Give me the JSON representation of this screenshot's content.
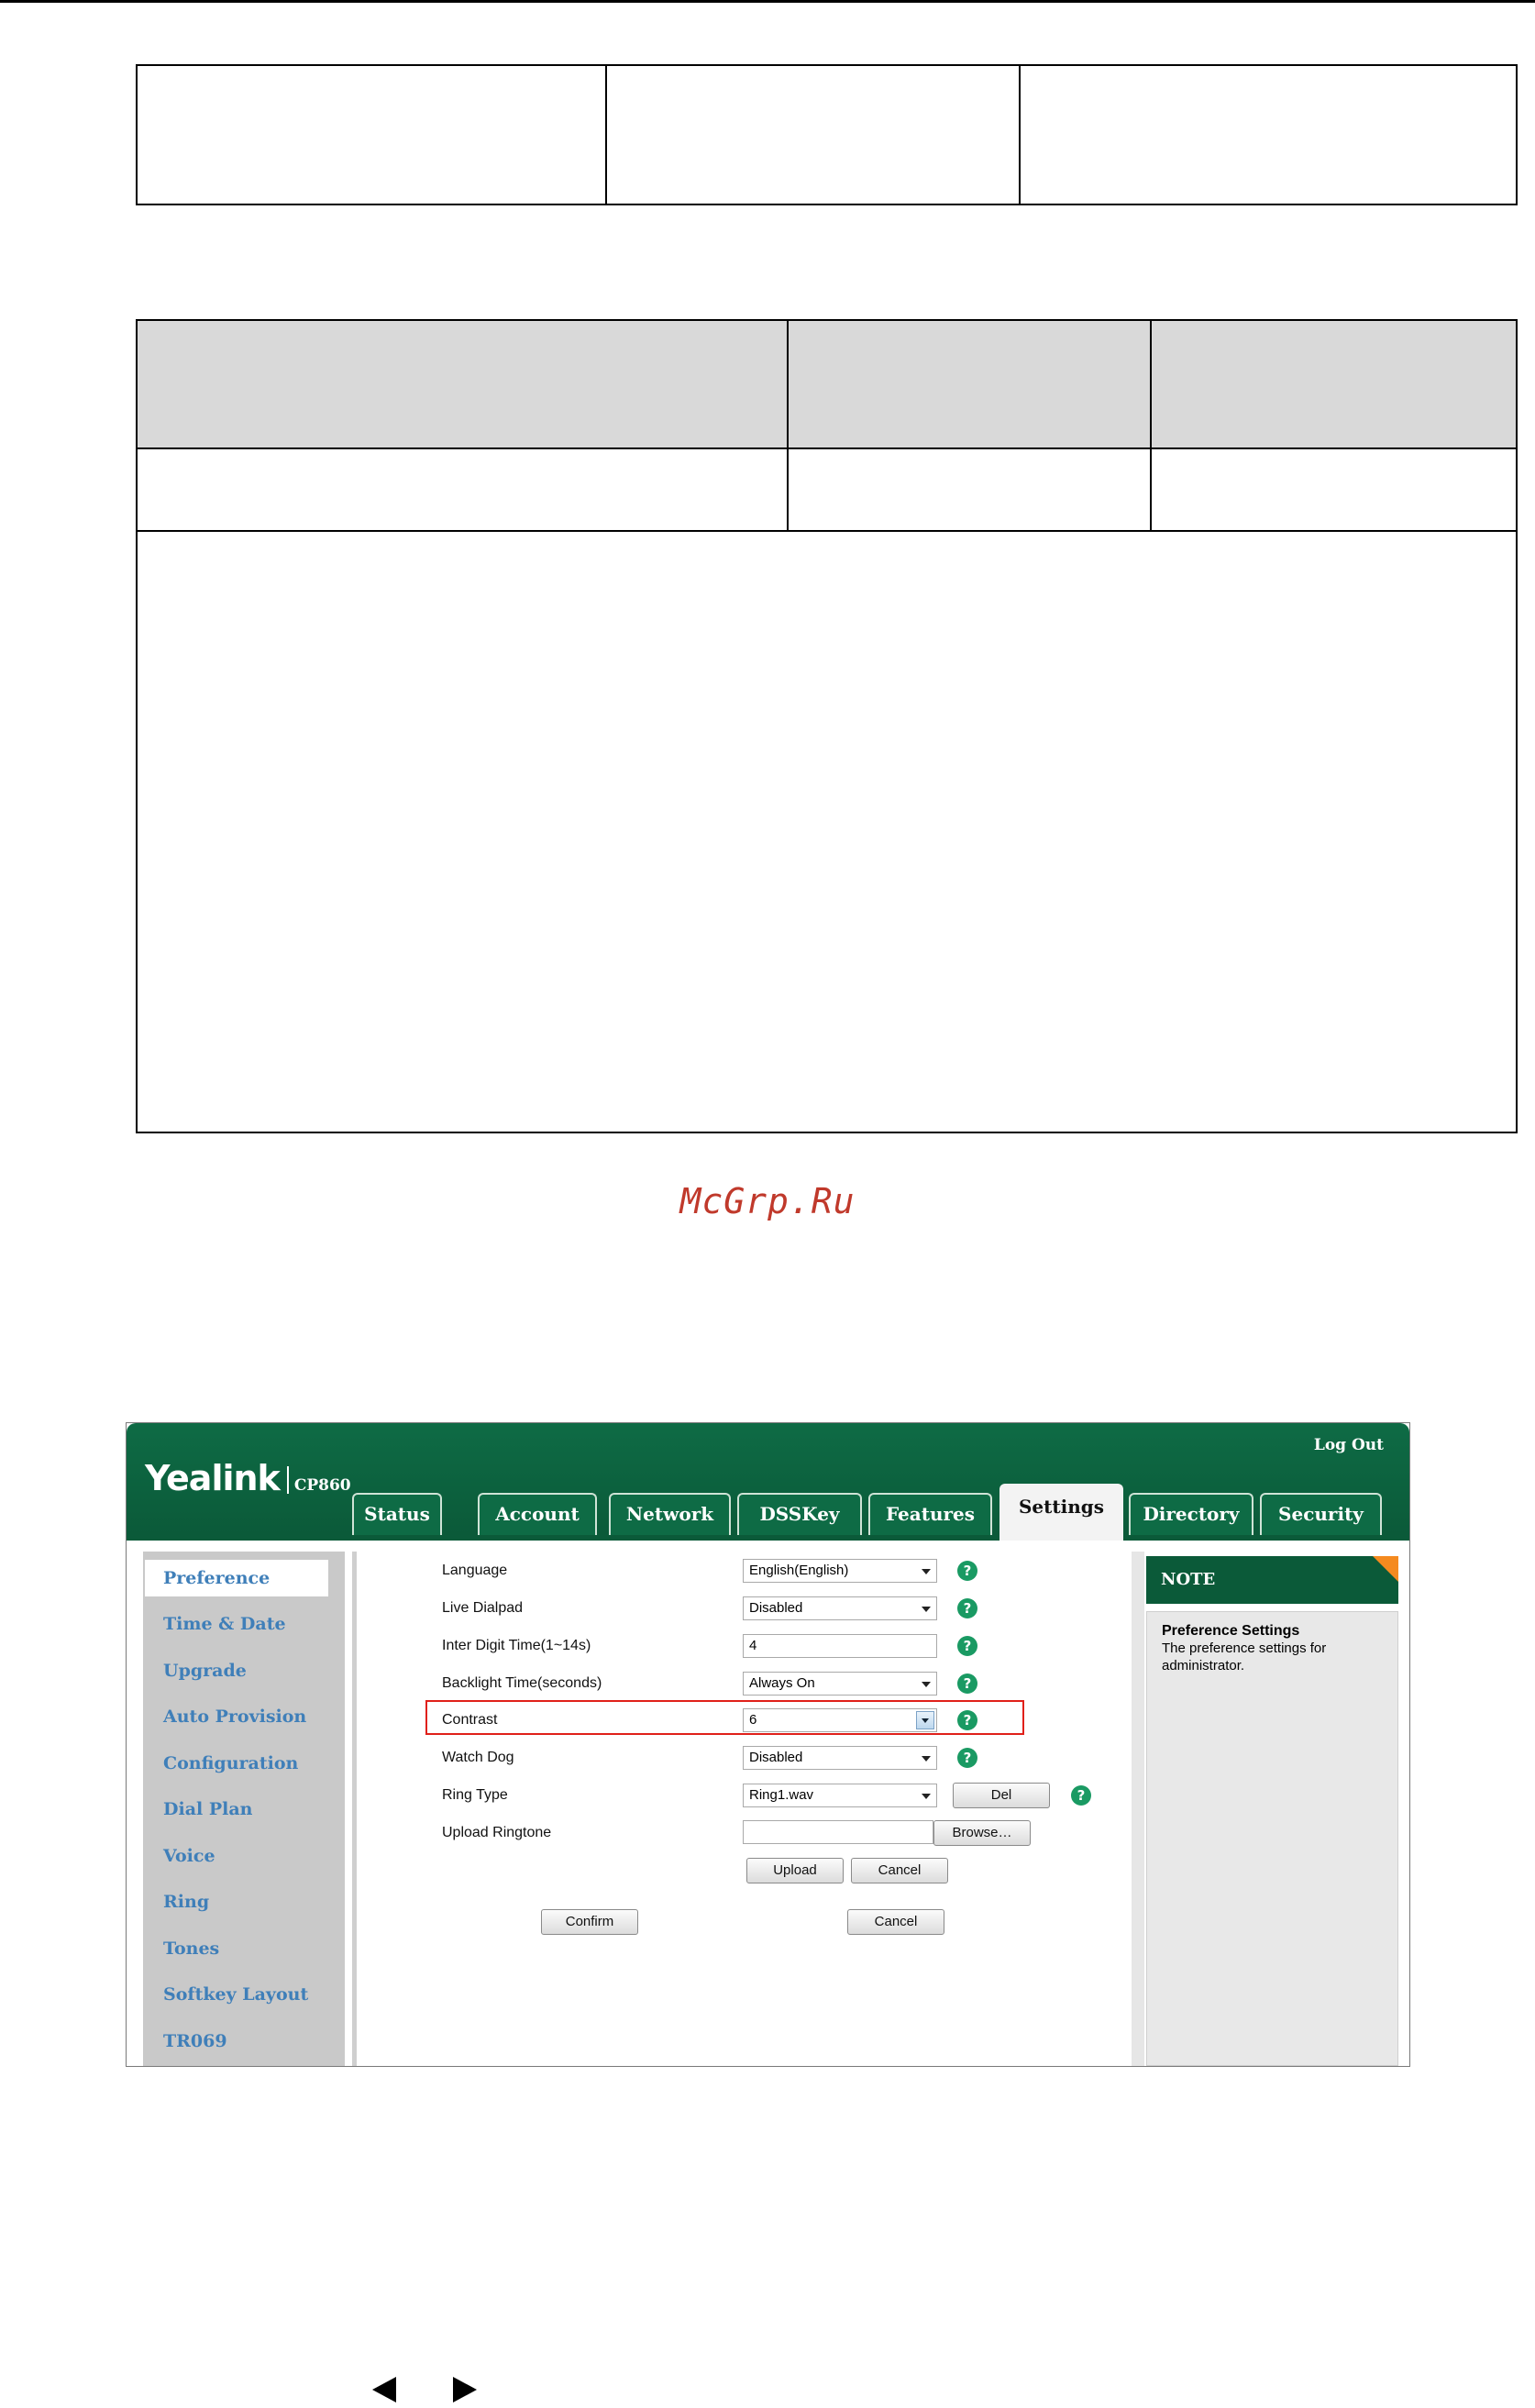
{
  "watermark": "McGrp.Ru",
  "header": {
    "logo_brand": "Yealink",
    "logo_model": "CP860",
    "logout": "Log Out"
  },
  "tabs": [
    {
      "label": "Status"
    },
    {
      "label": "Account"
    },
    {
      "label": "Network"
    },
    {
      "label": "DSSKey"
    },
    {
      "label": "Features"
    },
    {
      "label": "Settings",
      "active": true
    },
    {
      "label": "Directory"
    },
    {
      "label": "Security"
    }
  ],
  "sidebar": {
    "items": [
      {
        "label": "Preference",
        "active": true
      },
      {
        "label": "Time & Date"
      },
      {
        "label": "Upgrade"
      },
      {
        "label": "Auto Provision"
      },
      {
        "label": "Configuration"
      },
      {
        "label": "Dial Plan"
      },
      {
        "label": "Voice"
      },
      {
        "label": "Ring"
      },
      {
        "label": "Tones"
      },
      {
        "label": "Softkey Layout"
      },
      {
        "label": "TR069"
      }
    ]
  },
  "form": {
    "language": {
      "label": "Language",
      "value": "English(English)"
    },
    "live_dialpad": {
      "label": "Live Dialpad",
      "value": "Disabled"
    },
    "inter_digit_time": {
      "label": "Inter Digit Time(1~14s)",
      "value": "4"
    },
    "backlight_time": {
      "label": "Backlight Time(seconds)",
      "value": "Always On"
    },
    "contrast": {
      "label": "Contrast",
      "value": "6"
    },
    "watch_dog": {
      "label": "Watch Dog",
      "value": "Disabled"
    },
    "ring_type": {
      "label": "Ring Type",
      "value": "Ring1.wav",
      "del_label": "Del"
    },
    "upload_ringtone": {
      "label": "Upload Ringtone",
      "value": "",
      "browse_label": "Browse…"
    },
    "upload_label": "Upload",
    "upload_cancel_label": "Cancel",
    "confirm_label": "Confirm",
    "cancel_label": "Cancel",
    "help_glyph": "?"
  },
  "note": {
    "heading": "NOTE",
    "title": "Preference Settings",
    "text": "The preference settings for administrator."
  },
  "colors": {
    "header_green": "#0b5a39",
    "nav_link": "#3f7fb9",
    "highlight_red": "#e0201a",
    "note_corner_orange": "#f58a1f"
  }
}
